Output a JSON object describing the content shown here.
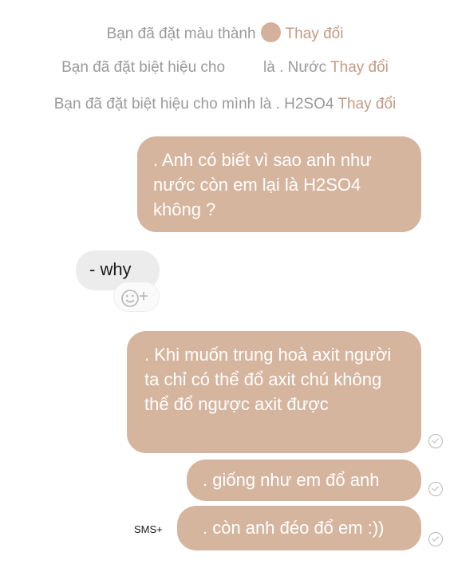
{
  "system_notices": [
    {
      "text": "Bạn đã đặt màu thành",
      "action": "Thay đổi"
    },
    {
      "text": "Bạn đã đặt biệt hiệu cho",
      "suffix": "là . Nước",
      "action": "Thay đổi"
    },
    {
      "text": "Bạn đã đặt biệt hiệu cho mình là . H2SO4",
      "action": "Thay đổi"
    }
  ],
  "messages": [
    {
      "direction": "sent",
      "text": ". Anh có biết vì sao anh như nước còn em lại là H2SO4 không ?"
    },
    {
      "direction": "received",
      "text": "- why"
    },
    {
      "direction": "sent",
      "text": ". Khi muốn trung hoà axit người ta chỉ có thể đổ axit chú không thể đổ ngược axit được",
      "status": "delivered"
    },
    {
      "direction": "sent",
      "text": ". giống như em đổ anh",
      "status": "delivered"
    },
    {
      "direction": "sent",
      "text": ". còn anh đéo đổ em :))",
      "status": "delivered"
    }
  ],
  "watermark": "SMS+",
  "colors": {
    "accent": "#c49a82",
    "bubble_sent": "#d6b59e",
    "bubble_received": "#ececec",
    "notice_text": "#9a9a9a"
  },
  "icons": {
    "reaction": "emoji-add-icon",
    "status": "delivered-check-icon"
  }
}
